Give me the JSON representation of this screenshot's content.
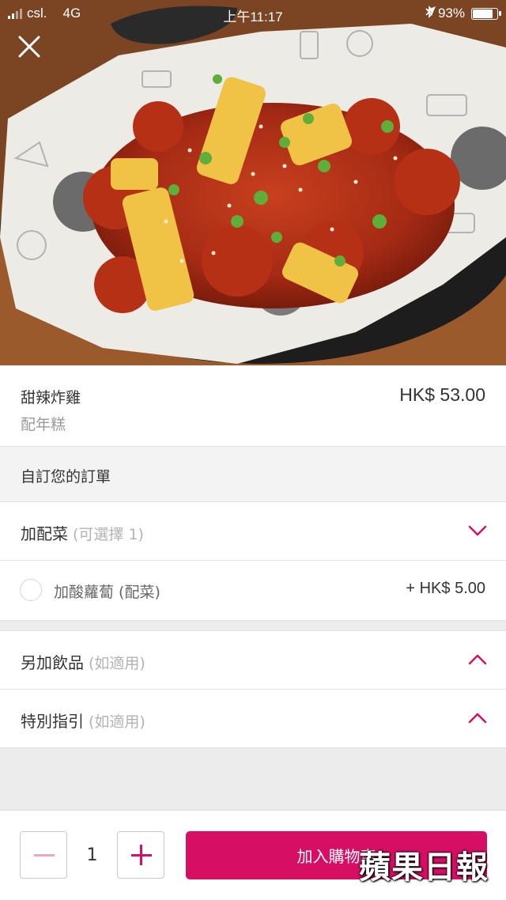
{
  "status_bar": {
    "carrier": "csl.",
    "network": "4G",
    "time": "上午11:17",
    "battery": "93%",
    "battery_level": 0.93
  },
  "item": {
    "name": "甜辣炸雞",
    "description": "配年糕",
    "price": "HK$ 53.00"
  },
  "customize": {
    "heading": "自訂您的訂單",
    "sections": [
      {
        "title": "加配菜",
        "hint": "(可選擇 1)",
        "expanded": true
      },
      {
        "title": "另加飲品",
        "hint": "(如適用)",
        "expanded": false
      },
      {
        "title": "特別指引",
        "hint": "(如適用)",
        "expanded": false
      }
    ],
    "options": [
      {
        "label": "加酸蘿蔔 (配菜)",
        "price": "+ HK$ 5.00",
        "selected": false
      }
    ]
  },
  "cart": {
    "quantity": "1",
    "add_label": "加入購物車"
  },
  "watermark": "蘋果日報",
  "accent_color": "#d70f64"
}
